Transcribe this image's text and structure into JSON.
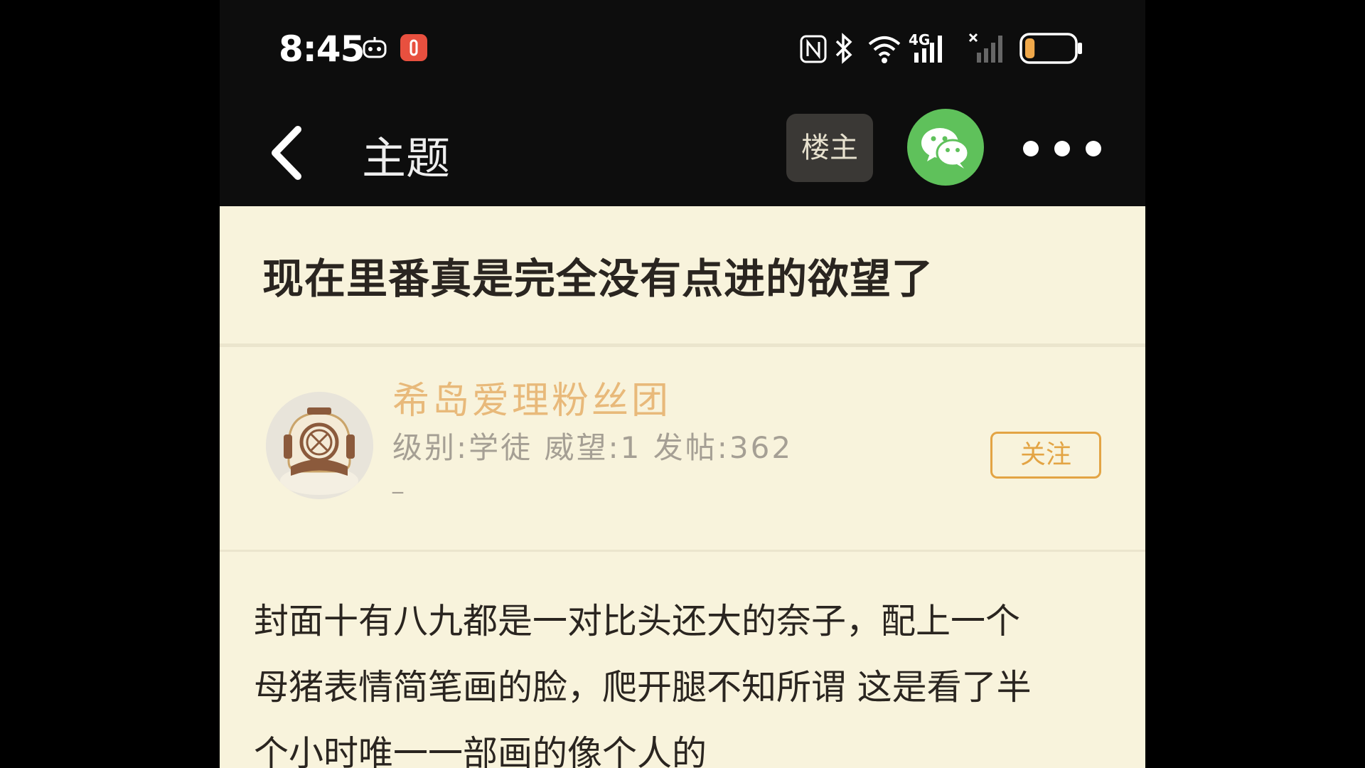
{
  "status_bar": {
    "time": "8:45",
    "battery_level": 0.2,
    "network": "4G",
    "icons": [
      "robot-notification-icon",
      "red-app-notification-icon",
      "nfc-icon",
      "bluetooth-icon",
      "wifi-icon",
      "cellular-signal-icon",
      "cellular-signal-noservice-icon",
      "battery-icon"
    ]
  },
  "app_bar": {
    "title": "主题",
    "op_only_label": "楼主",
    "icons": [
      "back-chevron-icon",
      "wechat-icon",
      "more-dots-icon"
    ]
  },
  "post": {
    "title": "现在里番真是完全没有点进的欲望了",
    "author": {
      "name": "希岛爱理粉丝团",
      "stats": "级别:学徒 威望:1 发帖:362",
      "signature": "_",
      "avatar_icon": "diving-helmet-avatar-icon"
    },
    "follow_label": "关注",
    "content_lines": [
      "封面十有八九都是一对比头还大的奈子，配上一个",
      "母猪表情简笔画的脸，爬开腿不知所谓 这是看了半",
      "个小时唯一一部画的像个人的"
    ]
  },
  "colors": {
    "background": "#f8f3dc",
    "header": "#0d0d0d",
    "author_name": "#e8b97a",
    "accent": "#e3a444",
    "wechat_green": "#5fc15b"
  }
}
